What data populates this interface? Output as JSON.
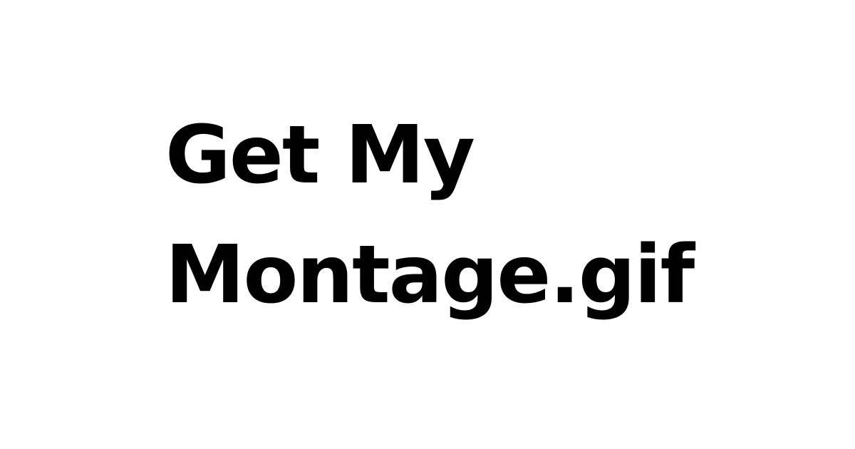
{
  "title": {
    "line1": "Get My",
    "line2": "Montage.gif"
  },
  "colors": {
    "background": "#ffffff",
    "text": "#000000"
  }
}
